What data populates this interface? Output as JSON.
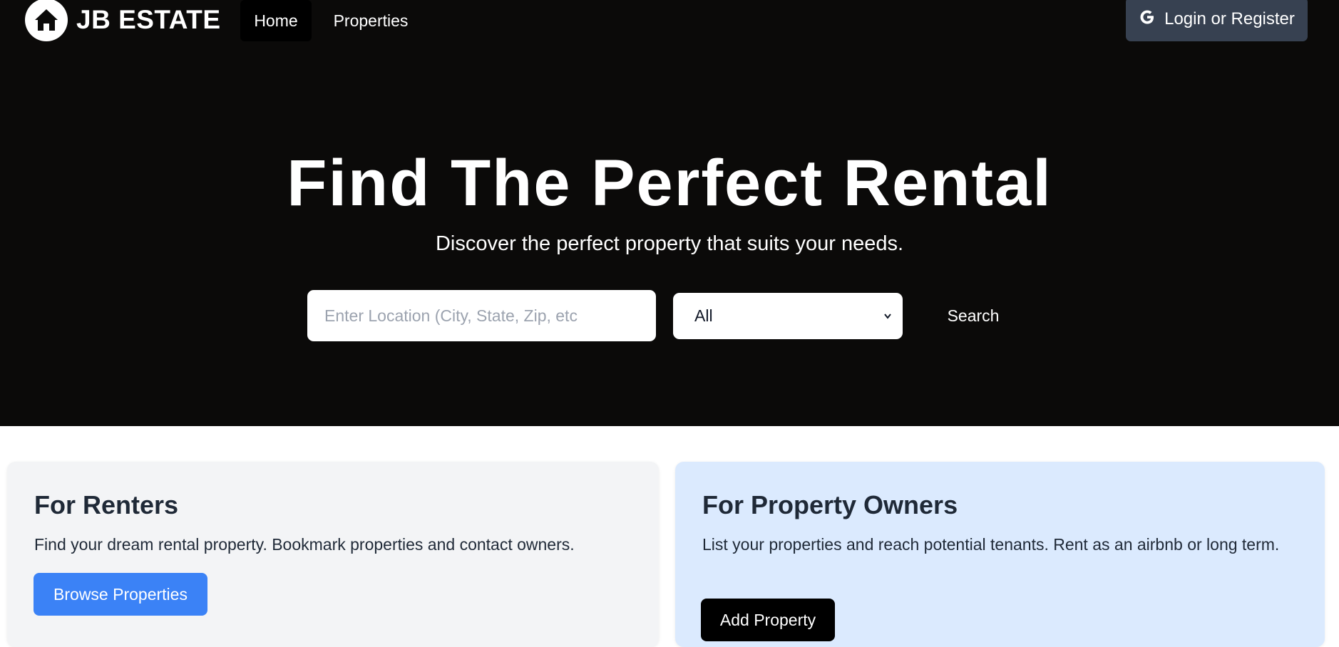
{
  "brand": {
    "name": "JB ESTATE",
    "logo_icon": "house-icon"
  },
  "nav": {
    "home": "Home",
    "properties": "Properties"
  },
  "login": {
    "label": "Login or Register",
    "icon": "google-icon"
  },
  "hero": {
    "title": "Find The Perfect Rental",
    "subtitle": "Discover the perfect property that suits your needs."
  },
  "search": {
    "placeholder": "Enter Location (City, State, Zip, etc",
    "type_selected": "All",
    "button": "Search"
  },
  "renters": {
    "title": "For Renters",
    "text": "Find your dream rental property. Bookmark properties and contact owners.",
    "button": "Browse Properties"
  },
  "owners": {
    "title": "For Property Owners",
    "text": "List your properties and reach potential tenants. Rent as an airbnb or long term.",
    "button": "Add Property"
  },
  "colors": {
    "header_bg": "#0b0a09",
    "login_bg": "#374151",
    "browse_button": "#3b82f6",
    "renters_card": "#f3f4f6",
    "owners_card": "#dbeafe"
  }
}
